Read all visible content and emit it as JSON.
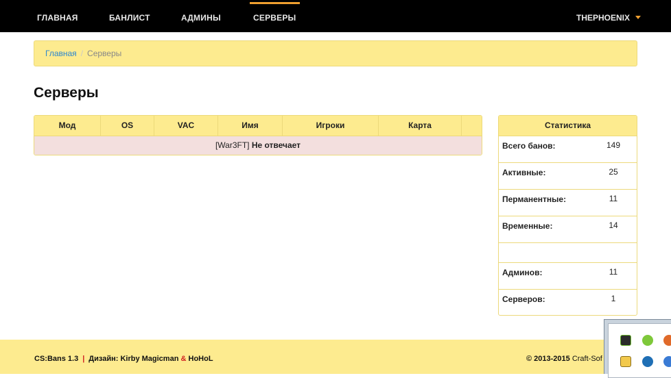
{
  "nav": {
    "items": [
      {
        "label": "ГЛАВНАЯ"
      },
      {
        "label": "БАНЛИСТ"
      },
      {
        "label": "АДМИНЫ"
      },
      {
        "label": "СЕРВЕРЫ",
        "active": true
      }
    ],
    "user": "THEPHOENIX",
    "accent_color": "#f0a030"
  },
  "breadcrumb": {
    "home": "Главная",
    "separator": "/",
    "current": "Серверы"
  },
  "page_title": "Серверы",
  "servers_table": {
    "columns": [
      "Мод",
      "OS",
      "VAC",
      "Имя",
      "Игроки",
      "Карта",
      ""
    ],
    "rows": [
      {
        "prefix": "[War3FT]",
        "status": "Не отвечает"
      }
    ]
  },
  "stats": {
    "title": "Статистика",
    "rows": [
      {
        "label": "Всего банов:",
        "value": "149"
      },
      {
        "label": "Активные:",
        "value": "25"
      },
      {
        "label": "Перманентные:",
        "value": "11"
      },
      {
        "label": "Временные:",
        "value": "14"
      },
      {
        "label": "",
        "value": ""
      },
      {
        "label": "Админов:",
        "value": "11"
      },
      {
        "label": "Серверов:",
        "value": "1"
      }
    ]
  },
  "footer": {
    "version": "CS:Bans 1.3",
    "pipe": "|",
    "design_label": "Дизайн: Kirby Magicman",
    "amp": "&",
    "design_author2": "HoHoL",
    "copyright": "© 2013-2015",
    "company": "Craft-Sof"
  },
  "colors": {
    "panel_yellow": "#fdeb8f",
    "row_error": "#f3dfde",
    "link_blue": "#2a86d0"
  }
}
